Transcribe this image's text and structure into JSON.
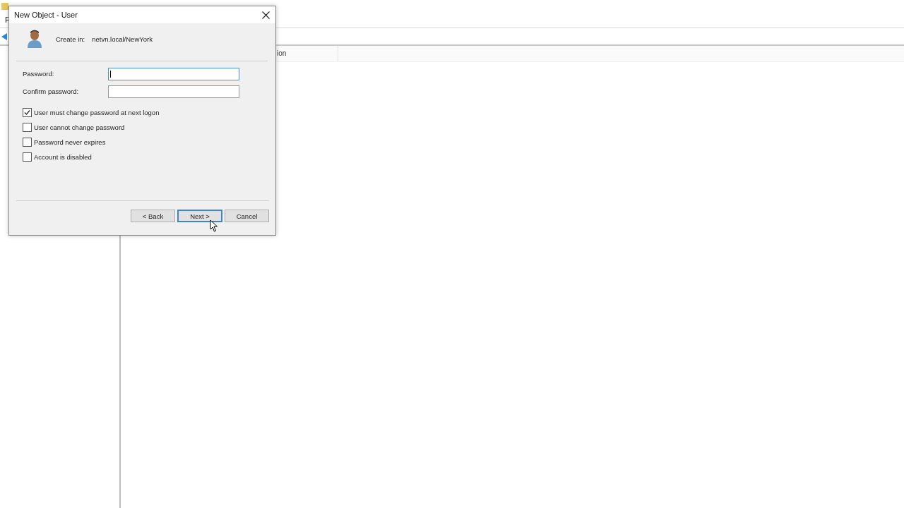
{
  "background_window": {
    "menu_items": [
      "F"
    ],
    "columns": [
      "ion"
    ]
  },
  "dialog": {
    "title": "New Object - User",
    "create_in_label": "Create in:",
    "create_in_path": "netvn.local/NewYork",
    "fields": [
      {
        "label": "Password:",
        "focused": true
      },
      {
        "label": "Confirm password:",
        "focused": false
      }
    ],
    "checkboxes": [
      {
        "label": "User must change password at next logon",
        "checked": true
      },
      {
        "label": "User cannot change password",
        "checked": false
      },
      {
        "label": "Password never expires",
        "checked": false
      },
      {
        "label": "Account is disabled",
        "checked": false
      }
    ],
    "buttons": [
      {
        "label": "< Back",
        "default": false
      },
      {
        "label": "Next >",
        "default": true
      },
      {
        "label": "Cancel",
        "default": false
      }
    ]
  }
}
